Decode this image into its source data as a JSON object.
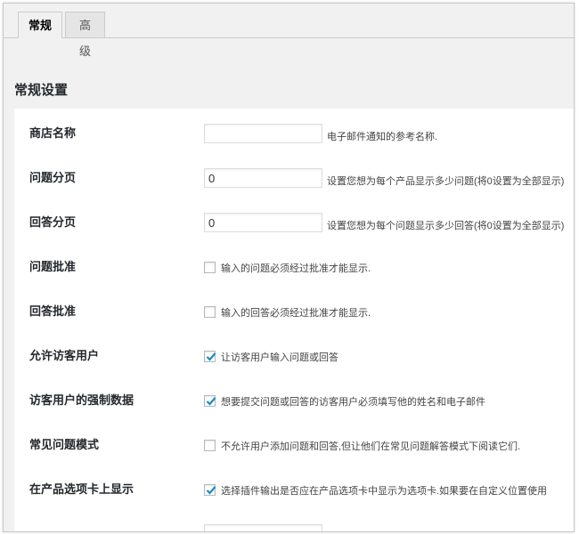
{
  "tabs": [
    {
      "label": "常规",
      "active": true
    },
    {
      "label": "高级",
      "active": false
    }
  ],
  "section_title": "常规设置",
  "fields": {
    "shop_name": {
      "label": "商店名称",
      "value": "",
      "description": "电子邮件通知的参考名称."
    },
    "questions_per_page": {
      "label": "问题分页",
      "value": "0",
      "description": "设置您想为每个产品显示多少问题(将0设置为全部显示)"
    },
    "answers_per_page": {
      "label": "回答分页",
      "value": "0",
      "description": "设置您想为每个问题显示多少回答(将0设置为全部显示)"
    },
    "question_approval": {
      "label": "问题批准",
      "checked": false,
      "description": "输入的问题必须经过批准才能显示."
    },
    "answer_approval": {
      "label": "回答批准",
      "checked": false,
      "description": "输入的回答必须经过批准才能显示."
    },
    "allow_guests": {
      "label": "允许访客用户",
      "checked": true,
      "description": "让访客用户输入问题或回答"
    },
    "guest_required_data": {
      "label": "访客用户的强制数据",
      "checked": true,
      "description": "想要提交问题或回答的访客用户必须填写他的姓名和电子邮件"
    },
    "faq_mode": {
      "label": "常见问题模式",
      "checked": false,
      "description": "不允许用户添加问题和回答,但让他们在常见问题解答模式下阅读它们."
    },
    "show_on_product_tab": {
      "label": "在产品选项卡上显示",
      "checked": true,
      "description": "选择插件输出是否应在产品选项卡中显示为选项卡.如果要在自定义位置使用"
    }
  },
  "colors": {
    "checkmark": "#1e8cbe",
    "background": "#f1f1f1",
    "panel": "#ffffff"
  }
}
